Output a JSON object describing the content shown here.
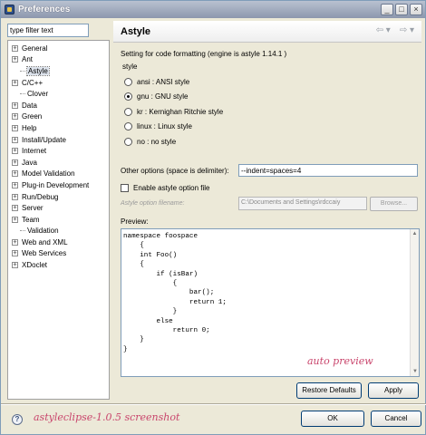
{
  "window": {
    "title": "Preferences",
    "minimize": "_",
    "maximize": "□",
    "close": "×"
  },
  "filter": {
    "value": "type filter text"
  },
  "tree": [
    {
      "label": "General",
      "expandable": true,
      "child": false
    },
    {
      "label": "Ant",
      "expandable": true,
      "child": false
    },
    {
      "label": "Astyle",
      "expandable": false,
      "child": true,
      "selected": true
    },
    {
      "label": "C/C++",
      "expandable": true,
      "child": false
    },
    {
      "label": "Clover",
      "expandable": false,
      "child": true
    },
    {
      "label": "Data",
      "expandable": true,
      "child": false
    },
    {
      "label": "Green",
      "expandable": true,
      "child": false
    },
    {
      "label": "Help",
      "expandable": true,
      "child": false
    },
    {
      "label": "Install/Update",
      "expandable": true,
      "child": false
    },
    {
      "label": "Internet",
      "expandable": true,
      "child": false
    },
    {
      "label": "Java",
      "expandable": true,
      "child": false
    },
    {
      "label": "Model Validation",
      "expandable": true,
      "child": false
    },
    {
      "label": "Plug-in Development",
      "expandable": true,
      "child": false
    },
    {
      "label": "Run/Debug",
      "expandable": true,
      "child": false
    },
    {
      "label": "Server",
      "expandable": true,
      "child": false
    },
    {
      "label": "Team",
      "expandable": true,
      "child": false
    },
    {
      "label": "Validation",
      "expandable": false,
      "child": true
    },
    {
      "label": "Web and XML",
      "expandable": true,
      "child": false
    },
    {
      "label": "Web Services",
      "expandable": true,
      "child": false
    },
    {
      "label": "XDoclet",
      "expandable": true,
      "child": false
    }
  ],
  "panel": {
    "title": "Astyle",
    "back_arrow": "⇦ ▾",
    "fwd_arrow": "⇨ ▾",
    "setting_text": "Setting for code formatting (engine is astyle 1.14.1 )",
    "style_label": "style",
    "styles": [
      {
        "label": "ansi : ANSI style",
        "selected": false
      },
      {
        "label": "gnu : GNU style",
        "selected": true
      },
      {
        "label": "kr : Kernighan Ritchie style",
        "selected": false
      },
      {
        "label": "linux : Linux style",
        "selected": false
      },
      {
        "label": "no : no style",
        "selected": false
      }
    ],
    "other_label": "Other options (space is delimiter):",
    "other_value": "--indent=spaces=4",
    "enable_file_label": "Enable astyle option file",
    "enable_file_checked": false,
    "file_label": "Astyle option filename:",
    "file_value": "C:\\Documents and Settings\\rdccaiy",
    "browse_label": "Browse...",
    "preview_label": "Preview:",
    "code": [
      "namespace foospace",
      "    {",
      "    int Foo()",
      "    {",
      "        if (isBar)",
      "            {",
      "                bar();",
      "                return 1;",
      "            }",
      "        else",
      "            return 0;",
      "    }",
      "}"
    ],
    "preview_hint": "auto preview",
    "restore_label": "Restore Defaults",
    "apply_label": "Apply"
  },
  "footer": {
    "help": "?",
    "caption": "astyleclipse-1.0.5 screenshot",
    "ok_label": "OK",
    "cancel_label": "Cancel"
  }
}
